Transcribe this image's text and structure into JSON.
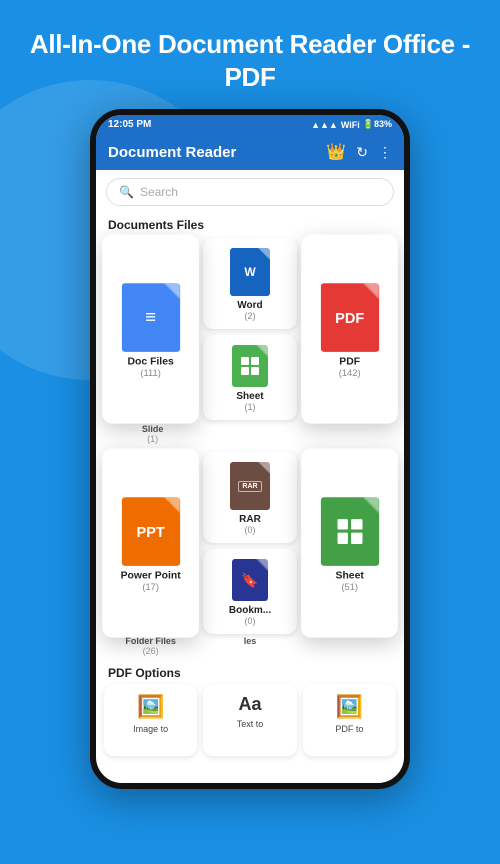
{
  "app": {
    "header": "All-In-One Document Reader Office - PDF",
    "statusBar": {
      "time": "12:05 PM",
      "signal": "▲▲▲",
      "wifi": "WiFi",
      "battery": "83"
    },
    "appBar": {
      "title": "Document Reader",
      "crownIcon": "👑",
      "refreshLabel": "↻",
      "moreLabel": "⋮"
    },
    "searchPlaceholder": "Search",
    "sections": {
      "documentsFiles": "Documents Files",
      "pdfOptions": "PDF Options"
    }
  },
  "docCards": [
    {
      "id": "doc-files",
      "label": "Doc Files",
      "count": "(111)",
      "type": "doc",
      "color": "blue",
      "featured": true
    },
    {
      "id": "word",
      "label": "Word",
      "count": "(2)",
      "type": "word",
      "color": "blue2"
    },
    {
      "id": "pdf",
      "label": "PDF",
      "count": "(142)",
      "type": "pdf",
      "color": "red",
      "featured": true
    },
    {
      "id": "slide",
      "label": "Slide",
      "count": "(1)",
      "type": "slide",
      "color": "orange-light"
    },
    {
      "id": "sheet",
      "label": "Sheet",
      "count": "(1)",
      "type": "sheet",
      "color": "green"
    }
  ],
  "docCards2": [
    {
      "id": "power-point",
      "label": "Power Point",
      "count": "(17)",
      "type": "ppt",
      "color": "orange",
      "featured": true
    },
    {
      "id": "rar",
      "label": "RAR",
      "count": "(0)",
      "type": "rar",
      "color": "brown"
    },
    {
      "id": "sheet2",
      "label": "Sheet",
      "count": "(51)",
      "type": "sheet",
      "color": "green2",
      "featured": true
    },
    {
      "id": "folder-files",
      "label": "Folder Files",
      "count": "(26)",
      "type": "folder",
      "color": "yellow"
    },
    {
      "id": "ies",
      "label": "Ies",
      "count": "",
      "type": "ies",
      "color": "blue"
    },
    {
      "id": "bookmark",
      "label": "Bookm...",
      "count": "(0)",
      "type": "bookmark",
      "color": "navy"
    }
  ],
  "pdfOptions": [
    {
      "id": "image-to",
      "label": "Image to",
      "icon": "🖼️"
    },
    {
      "id": "text-to",
      "label": "Text to",
      "icon": "Aa"
    },
    {
      "id": "pdf-to",
      "label": "PDF to",
      "icon": "🖼️"
    }
  ]
}
